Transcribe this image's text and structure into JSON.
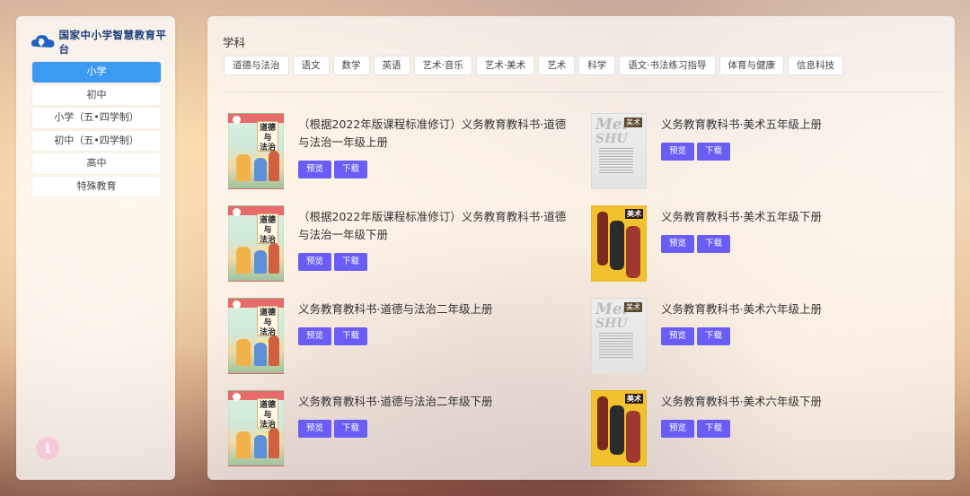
{
  "sidebar": {
    "logo_text": "国家中小学智慧教育平台",
    "items": [
      {
        "label": "小学",
        "active": true
      },
      {
        "label": "初中",
        "active": false
      },
      {
        "label": "小学（五•四学制）",
        "active": false
      },
      {
        "label": "初中（五•四学制）",
        "active": false
      },
      {
        "label": "高中",
        "active": false
      },
      {
        "label": "特殊教育",
        "active": false
      }
    ],
    "info_icon": "i"
  },
  "main": {
    "section_title": "学科",
    "subjects": [
      "道德与法治",
      "语文",
      "数学",
      "英语",
      "艺术·音乐",
      "艺术·美术",
      "艺术",
      "科学",
      "语文·书法练习指导",
      "体育与健康",
      "信息科技"
    ],
    "buttons": {
      "preview": "预览",
      "download": "下载"
    },
    "books_left": [
      {
        "title": "（根据2022年版课程标准修订）义务教育教科书·道德与法治一年级上册"
      },
      {
        "title": "（根据2022年版课程标准修订）义务教育教科书·道德与法治一年级下册"
      },
      {
        "title": "义务教育教科书·道德与法治二年级上册"
      },
      {
        "title": "义务教育教科书·道德与法治二年级下册"
      }
    ],
    "books_right": [
      {
        "title": "义务教育教科书·美术五年级上册"
      },
      {
        "title": "义务教育教科书·美术五年级下册"
      },
      {
        "title": "义务教育教科书·美术六年级上册"
      },
      {
        "title": "义务教育教科书·美术六年级下册"
      }
    ],
    "cover_text": {
      "mf_line1": "道德",
      "mf_line2": "与",
      "mf_line3": "法治",
      "art_big1": "Mei",
      "art_big2": "SHU",
      "art_label": "美术"
    }
  },
  "colors": {
    "active_nav": "#3d9af3",
    "button": "#6a5df5",
    "logo_text": "#1c3f7a"
  }
}
